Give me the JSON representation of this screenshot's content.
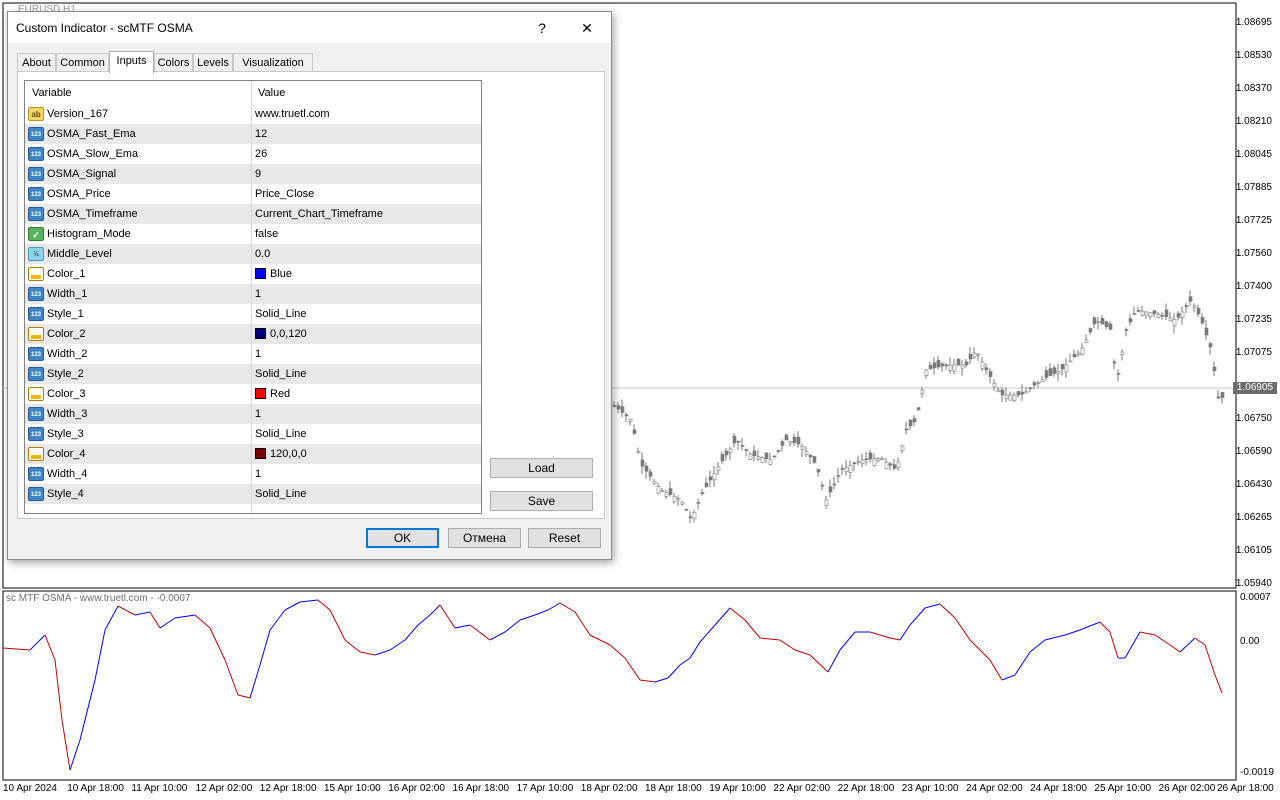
{
  "chart": {
    "symbol": "EURUSD,H1",
    "price_labels": [
      "1.08695",
      "1.08530",
      "1.08370",
      "1.08210",
      "1.08045",
      "1.07885",
      "1.07725",
      "1.07560",
      "1.07400",
      "1.07235",
      "1.07075",
      "1.06750",
      "1.06590",
      "1.06430",
      "1.06265",
      "1.06105",
      "1.05940"
    ],
    "current_price": "1.06905",
    "osma_title": "sc MTF OSMA - www.truetl.com - -0.0007",
    "osma_scale": [
      "0.0007",
      "0.00",
      "-0.0019"
    ],
    "time_labels": [
      "10 Apr 2024",
      "10 Apr 18:00",
      "11 Apr 10:00",
      "12 Apr 02:00",
      "12 Apr 18:00",
      "15 Apr 10:00",
      "16 Apr 02:00",
      "16 Apr 18:00",
      "17 Apr 10:00",
      "18 Apr 02:00",
      "18 Apr 18:00",
      "19 Apr 10:00",
      "22 Apr 02:00",
      "22 Apr 18:00",
      "23 Apr 10:00",
      "24 Apr 02:00",
      "24 Apr 18:00",
      "25 Apr 10:00",
      "26 Apr 02:00",
      "26 Apr 18:00"
    ],
    "colors": {
      "osma_up": "#0000ff",
      "osma_down": "#c00000",
      "candle": "#7a7a7a"
    }
  },
  "dialog": {
    "title": "Custom Indicator - scMTF OSMA",
    "help_label": "?",
    "close_label": "✕",
    "tabs": [
      {
        "label": "About",
        "active": false
      },
      {
        "label": "Common",
        "active": false
      },
      {
        "label": "Inputs",
        "active": true
      },
      {
        "label": "Colors",
        "active": false
      },
      {
        "label": "Levels",
        "active": false
      },
      {
        "label": "Visualization",
        "active": false
      }
    ],
    "grid": {
      "col_variable": "Variable",
      "col_value": "Value",
      "rows": [
        {
          "icon": "string-icon",
          "variable": "Version_167",
          "value": "www.truetl.com"
        },
        {
          "icon": "integer-icon",
          "variable": "OSMA_Fast_Ema",
          "value": "12"
        },
        {
          "icon": "integer-icon",
          "variable": "OSMA_Slow_Ema",
          "value": "26"
        },
        {
          "icon": "integer-icon",
          "variable": "OSMA_Signal",
          "value": "9"
        },
        {
          "icon": "integer-icon",
          "variable": "OSMA_Price",
          "value": "Price_Close"
        },
        {
          "icon": "integer-icon",
          "variable": "OSMA_Timeframe",
          "value": "Current_Chart_Timeframe"
        },
        {
          "icon": "bool-icon",
          "variable": "Histogram_Mode",
          "value": "false"
        },
        {
          "icon": "double-icon",
          "variable": "Middle_Level",
          "value": "0.0"
        },
        {
          "icon": "color-icon",
          "variable": "Color_1",
          "value": "Blue",
          "swatch": "#0000ff"
        },
        {
          "icon": "integer-icon",
          "variable": "Width_1",
          "value": "1"
        },
        {
          "icon": "integer-icon",
          "variable": "Style_1",
          "value": "Solid_Line"
        },
        {
          "icon": "color-icon",
          "variable": "Color_2",
          "value": "0,0,120",
          "swatch": "#000078"
        },
        {
          "icon": "integer-icon",
          "variable": "Width_2",
          "value": "1"
        },
        {
          "icon": "integer-icon",
          "variable": "Style_2",
          "value": "Solid_Line"
        },
        {
          "icon": "color-icon",
          "variable": "Color_3",
          "value": "Red",
          "swatch": "#ff0000"
        },
        {
          "icon": "integer-icon",
          "variable": "Width_3",
          "value": "1"
        },
        {
          "icon": "integer-icon",
          "variable": "Style_3",
          "value": "Solid_Line"
        },
        {
          "icon": "color-icon",
          "variable": "Color_4",
          "value": "120,0,0",
          "swatch": "#780000"
        },
        {
          "icon": "integer-icon",
          "variable": "Width_4",
          "value": "1"
        },
        {
          "icon": "integer-icon",
          "variable": "Style_4",
          "value": "Solid_Line"
        }
      ]
    },
    "buttons": {
      "load": "Load",
      "save": "Save",
      "ok": "OK",
      "cancel": "Отмена",
      "reset": "Reset"
    },
    "icon_glyphs": {
      "string-icon": "ab",
      "integer-icon": "123",
      "bool-icon": "✓",
      "double-icon": "½",
      "color-icon": ""
    }
  }
}
